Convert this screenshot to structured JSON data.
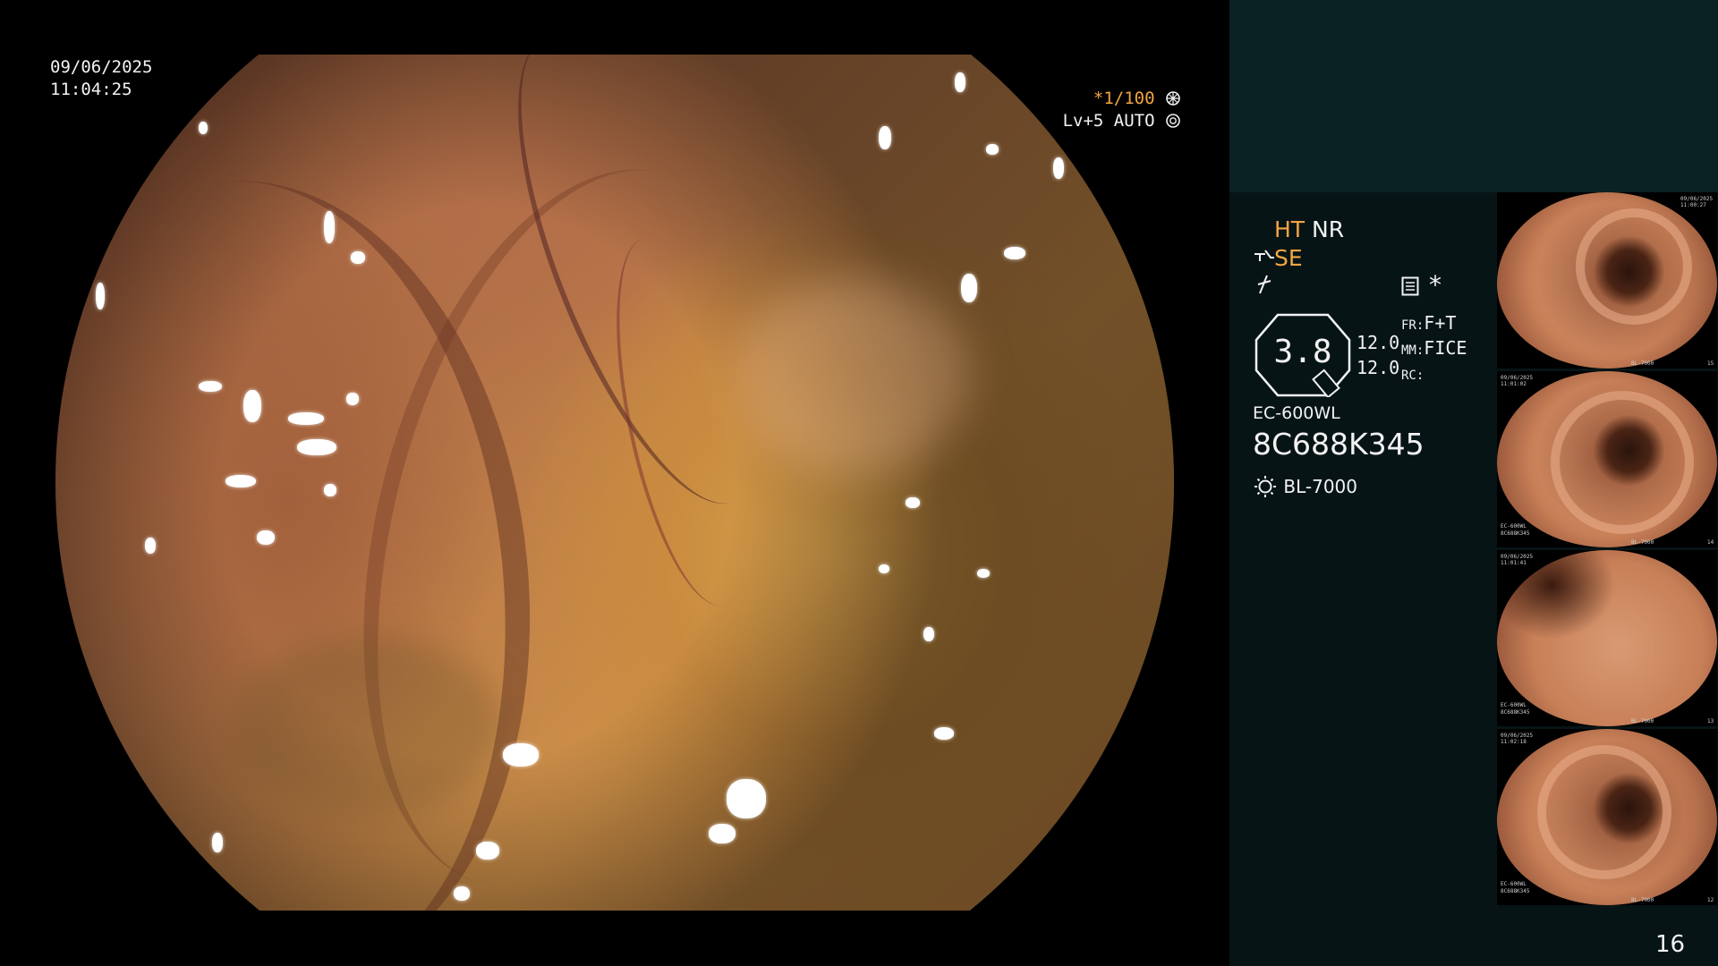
{
  "overlay": {
    "date": "09/06/2025",
    "time": "11:04:25",
    "shutter": "*1/100",
    "level": "Lv+5 AUTO"
  },
  "info": {
    "mode_ht": "HT",
    "mode_nr": "NR",
    "mode_se": "SE",
    "zoom_value": "3.8",
    "value_top": "12.0",
    "value_bottom": "12.0",
    "fr_label": "FR:",
    "fr_value": "F+T",
    "mm_label": "MM:",
    "mm_value": "FICE",
    "rc_label": "RC:",
    "scope_model": "EC-600WL",
    "serial": "8C688K345",
    "light_source": "BL-7000",
    "asterisk": "*"
  },
  "thumbnails": [
    {
      "date": "09/06/2025",
      "time": "11:00:27",
      "model": "EC-600WL",
      "serial": "8C688K345",
      "light": "BL-7000",
      "index": "15"
    },
    {
      "date": "09/06/2025",
      "time": "11:01:02",
      "model": "EC-600WL",
      "serial": "8C688K345",
      "light": "BL-7000",
      "index": "14"
    },
    {
      "date": "09/06/2025",
      "time": "11:01:41",
      "model": "EC-600WL",
      "serial": "8C688K345",
      "light": "BL-7000",
      "index": "13"
    },
    {
      "date": "09/06/2025",
      "time": "11:02:18",
      "model": "EC-600WL",
      "serial": "8C688K345",
      "light": "BL-7000",
      "index": "12"
    }
  ],
  "frame_count": "16",
  "colors": {
    "accent_orange": "#f2a544",
    "panel_dark": "#071416",
    "panel_band": "#0b2224",
    "text_white": "#f2f2f2"
  },
  "icons": [
    "aperture-icon",
    "settings-ring-icon",
    "scope-tip-icon",
    "flash-icon",
    "menu-doc-icon",
    "lens-indicator-icon",
    "light-bulb-icon"
  ]
}
